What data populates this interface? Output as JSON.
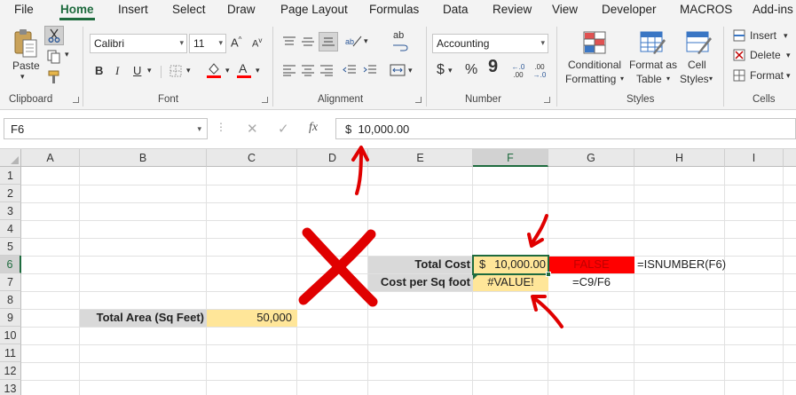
{
  "menu": {
    "tabs": [
      "File",
      "Home",
      "Insert",
      "Select",
      "Draw",
      "Page Layout",
      "Formulas",
      "Data",
      "Review",
      "View",
      "Developer",
      "MACROS",
      "Add-ins"
    ],
    "active": "Home"
  },
  "ribbon": {
    "clipboard": {
      "label": "Clipboard",
      "paste": "Paste"
    },
    "font": {
      "label": "Font",
      "name": "Calibri",
      "size": "11",
      "bold": "B",
      "italic": "I",
      "underline": "U",
      "grow": "A",
      "shrink": "A",
      "font_color_glyph": "A",
      "fill_color": "#ff0000",
      "font_color": "#ff0000"
    },
    "alignment": {
      "label": "Alignment",
      "wrap_glyph": "ab"
    },
    "number": {
      "label": "Number",
      "format": "Accounting",
      "currency": "$",
      "percent": "%",
      "comma": "9",
      "inc_dec_top": "←.0",
      "inc_dec_bottom": ".00",
      "dec_dec_top": ".00",
      "dec_dec_bottom": "→.0"
    },
    "styles": {
      "label": "Styles",
      "conditional_1": "Conditional",
      "conditional_2": "Formatting",
      "format_table_1": "Format as",
      "format_table_2": "Table",
      "cell_styles_1": "Cell",
      "cell_styles_2": "Styles"
    },
    "cells": {
      "label": "Cells",
      "insert": "Insert",
      "delete": "Delete",
      "format": "Format"
    }
  },
  "formula_bar": {
    "name_box": "F6",
    "cancel": "✕",
    "enter": "✓",
    "fx": "fx",
    "formula": "$  10,000.00"
  },
  "sheet": {
    "columns": [
      "A",
      "B",
      "C",
      "D",
      "E",
      "F",
      "G",
      "H",
      "I"
    ],
    "rows": [
      "1",
      "2",
      "3",
      "4",
      "5",
      "6",
      "7",
      "8",
      "9",
      "10",
      "11",
      "12",
      "13"
    ],
    "selected_column": "F",
    "selected_row": "6",
    "cells": {
      "E6": "Total Cost",
      "F6_currency": "$",
      "F6_value": "10,000.00",
      "G6": "FALSE",
      "H6": "=ISNUMBER(F6)",
      "E7": "Cost per Sq foot",
      "F7": "#VALUE!",
      "G7": "=C9/F6",
      "B9": "Total Area (Sq Feet)",
      "C9": "50,000"
    },
    "colors": {
      "label_fill": "#d9d9d9",
      "input_fill": "#ffe699",
      "false_fill": "#ff0000",
      "false_text": "#c00000",
      "selection_border": "#1e6b3e",
      "annotation": "#e00000"
    }
  }
}
